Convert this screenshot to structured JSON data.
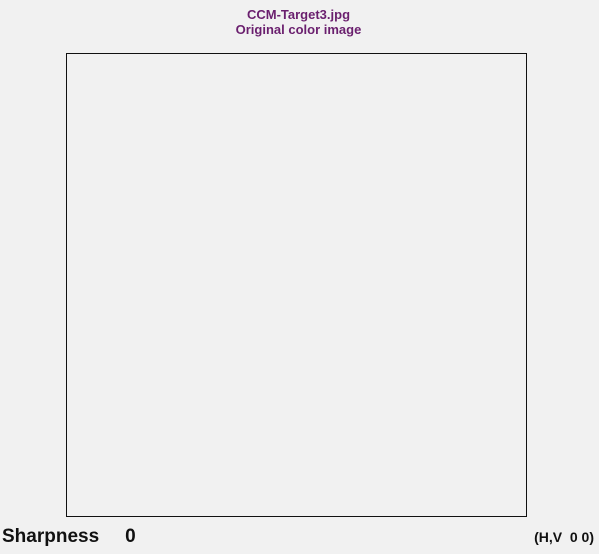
{
  "title": {
    "filename": "CCM-Target3.jpg",
    "subtitle": "Original color image"
  },
  "footer": {
    "sharpness_label": "Sharpness",
    "sharpness_value": "0",
    "hv_readout": "(H,V  0 0)"
  }
}
